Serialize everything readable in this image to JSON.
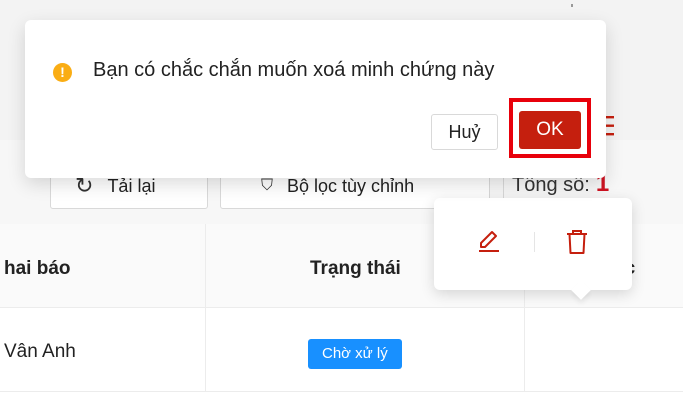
{
  "toolbar": {
    "reload_label": "Tải lại",
    "reload_icon": "reload-icon",
    "filter_label": "Bộ lọc tùy chỉnh",
    "filter_icon": "filter-icon",
    "total_label": "Tổng số:",
    "total_count": "1"
  },
  "table": {
    "columns": [
      "Người khai báo",
      "Trạng thái",
      "Thao tác"
    ],
    "visible_headers": {
      "reporter": "hai báo",
      "status": "Trạng thái",
      "action": "ác"
    },
    "rows": [
      {
        "reporter": "Vân Anh",
        "status": "Chờ xử lý",
        "action_icon": "menu-icon"
      }
    ]
  },
  "action_popover": {
    "edit_icon": "edit-icon",
    "delete_icon": "trash-icon"
  },
  "confirm_dialog": {
    "icon": "warning-icon",
    "message": "Bạn có chắc chắn muốn xoá minh chứng này",
    "cancel_label": "Huỷ",
    "ok_label": "OK"
  },
  "colors": {
    "danger": "#c51f0e",
    "highlight": "#e8000b",
    "warning": "#faad14",
    "status_badge": "#1890ff",
    "total_count": "#cf1322"
  }
}
